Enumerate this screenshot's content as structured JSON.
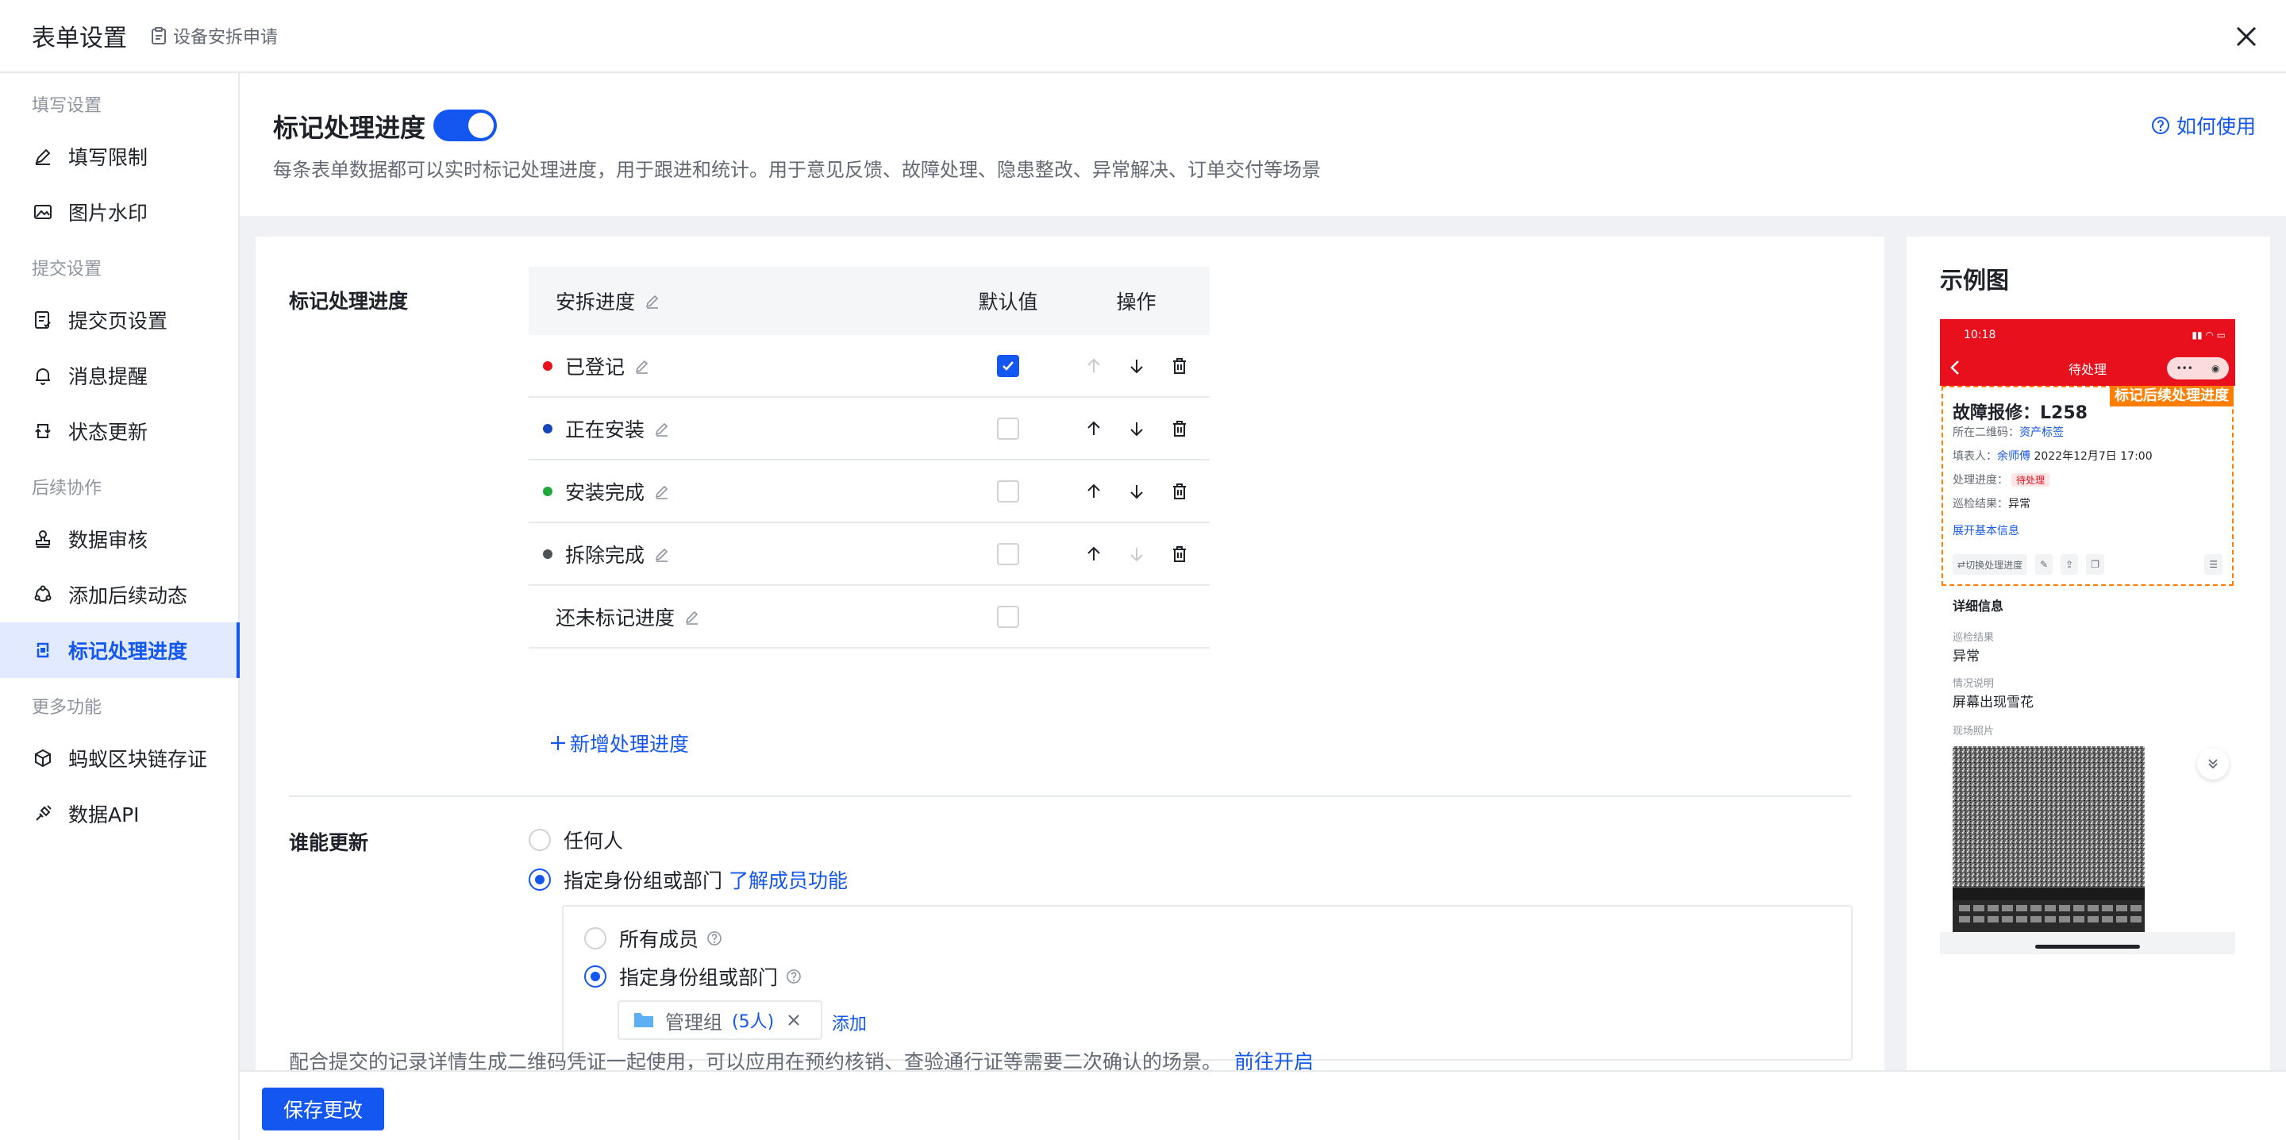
{
  "topbar": {
    "title": "表单设置",
    "subtitle": "设备安拆申请"
  },
  "sidebar": {
    "groups": [
      {
        "label": "填写设置",
        "items": [
          {
            "label": "填写限制",
            "icon": "pen-icon"
          },
          {
            "label": "图片水印",
            "icon": "image-icon"
          }
        ]
      },
      {
        "label": "提交设置",
        "items": [
          {
            "label": "提交页设置",
            "icon": "form-icon"
          },
          {
            "label": "消息提醒",
            "icon": "bell-icon"
          },
          {
            "label": "状态更新",
            "icon": "sync-icon"
          }
        ]
      },
      {
        "label": "后续协作",
        "items": [
          {
            "label": "数据审核",
            "icon": "stamp-icon"
          },
          {
            "label": "添加后续动态",
            "icon": "dynamic-icon"
          },
          {
            "label": "标记处理进度",
            "icon": "progress-icon",
            "active": true
          }
        ]
      },
      {
        "label": "更多功能",
        "items": [
          {
            "label": "蚂蚁区块链存证",
            "icon": "blockchain-icon"
          },
          {
            "label": "数据API",
            "icon": "api-icon"
          }
        ]
      }
    ]
  },
  "header": {
    "title": "标记处理进度",
    "enabled": true,
    "description": "每条表单数据都可以实时标记处理进度，用于跟进和统计。用于意见反馈、故障处理、隐患整改、异常解决、订单交付等场景",
    "help": "如何使用"
  },
  "progress": {
    "section_label": "标记处理进度",
    "table": {
      "col_name": "安拆进度",
      "col_default": "默认值",
      "col_ops": "操作",
      "rows": [
        {
          "label": "已登记",
          "color": "#e8101c",
          "default": true,
          "up_enabled": false,
          "down_enabled": true
        },
        {
          "label": "正在安装",
          "color": "#1446b8",
          "default": false,
          "up_enabled": true,
          "down_enabled": true
        },
        {
          "label": "安装完成",
          "color": "#1ea83c",
          "default": false,
          "up_enabled": true,
          "down_enabled": true
        },
        {
          "label": "拆除完成",
          "color": "#4e5258",
          "default": false,
          "up_enabled": true,
          "down_enabled": false
        }
      ],
      "unmarked": {
        "label": "还未标记进度",
        "default": false
      }
    },
    "add_label": "新增处理进度"
  },
  "who": {
    "section_label": "谁能更新",
    "options": [
      {
        "label": "任何人",
        "selected": false
      },
      {
        "label": "指定身份组或部门",
        "selected": true
      }
    ],
    "learn_link": "了解成员功能",
    "sub_options": [
      {
        "label": "所有成员",
        "selected": false
      },
      {
        "label": "指定身份组或部门",
        "selected": true
      }
    ],
    "tag": {
      "name": "管理组",
      "count": "(5人)"
    },
    "add": "添加"
  },
  "example": {
    "title": "示例图",
    "phone": {
      "time": "10:18",
      "nav_title": "待处理",
      "highlight_badge": "标记后续处理进度",
      "record_title": "故障报修：L258",
      "qrcode_label": "所在二维码：",
      "qrcode_value": "资产标签",
      "filler_label": "填表人：",
      "filler_name": "余师傅",
      "filler_time": "2022年12月7日 17:00",
      "progress_label": "处理进度：",
      "progress_value": "待处理",
      "result_label": "巡检结果：",
      "result_value": "异常",
      "expand": "展开基本信息",
      "switch_action": "切换处理进度",
      "detail_title": "详细信息",
      "f1_label": "巡检结果",
      "f1_value": "异常",
      "f2_label": "情况说明",
      "f2_value": "屏幕出现雪花",
      "f3_label": "现场照片"
    }
  },
  "note": {
    "text": "配合提交的记录详情生成二维码凭证一起使用，可以应用在预约核销、查验通行证等需要二次确认的场景。",
    "link": "前往开启"
  },
  "footer": {
    "save": "保存更改"
  }
}
